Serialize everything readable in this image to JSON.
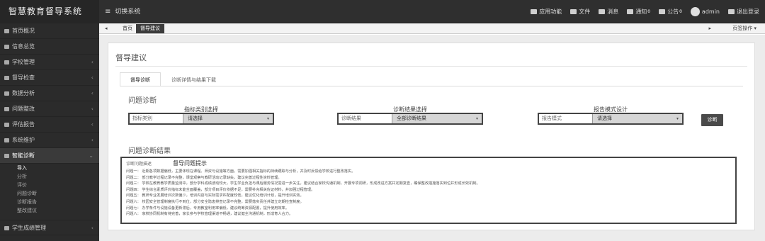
{
  "app": {
    "title": "智慧教育督导系统"
  },
  "header": {
    "system_switch": "切换系统"
  },
  "topnav": [
    {
      "icon": "grid-icon",
      "label": "应用功能",
      "badge": ""
    },
    {
      "icon": "doc-icon",
      "label": "文件",
      "badge": ""
    },
    {
      "icon": "list-icon",
      "label": "消息",
      "badge": ""
    },
    {
      "icon": "bell-icon",
      "label": "通知",
      "badge": "0"
    },
    {
      "icon": "mail-icon",
      "label": "公告",
      "badge": "0"
    },
    {
      "icon": "user-icon",
      "label": "admin",
      "badge": ""
    },
    {
      "icon": "logout-icon",
      "label": "退出登录",
      "badge": ""
    }
  ],
  "sidebar": {
    "items": [
      {
        "label": "首页概况",
        "caret": ""
      },
      {
        "label": "信息总览",
        "caret": ""
      },
      {
        "label": "学校管理",
        "caret": "‹"
      },
      {
        "label": "督导检查",
        "caret": "‹"
      },
      {
        "label": "数据分析",
        "caret": "‹"
      },
      {
        "label": "问题整改",
        "caret": "‹"
      },
      {
        "label": "评估报告",
        "caret": "‹"
      },
      {
        "label": "系统维护",
        "caret": "‹"
      },
      {
        "label": "智能诊断",
        "caret": "⌄"
      }
    ],
    "subitems": [
      {
        "label": "导入"
      },
      {
        "label": "分析"
      },
      {
        "label": "评价"
      },
      {
        "label": "问题诊断"
      },
      {
        "label": "诊断报告"
      },
      {
        "label": "整改建议"
      }
    ],
    "bottom_item": {
      "label": "学生成绩管理",
      "caret": "‹"
    }
  },
  "tabstrip": {
    "back": "◂",
    "home": "首页",
    "current": "督导建议",
    "more": "▸",
    "ops": "页签操作 ▾"
  },
  "main": {
    "title": "督导建议",
    "tabs": [
      {
        "label": "督导诊断"
      },
      {
        "label": "诊断详情与结果下载"
      }
    ],
    "section1_title": "问题诊断",
    "filters": [
      {
        "label": "指标类别选择",
        "placeholder": "指标类别",
        "value": "请选择"
      },
      {
        "label": "诊断结果选择",
        "placeholder": "诊断结果",
        "value": "全部诊断结果"
      },
      {
        "label": "报告模式设计",
        "placeholder": "报告模式",
        "value": "请选择"
      }
    ],
    "search_label": "诊断",
    "section2_title": "问题诊断结果",
    "result": {
      "tag": "诊断问题描述",
      "title": "督导问题提示",
      "lines": [
        "问题一：  近期各项数据偏低，主要体现在课程、师资与设施等方面，需要加强相关指标的持续跟踪与分析，并及时反馈给学校进行整改落实。",
        "问题二：  部分教学过程记录不完整，课堂观察与教研活动记录缺失，建议完善过程性资料管理。",
        "问题三：  学校在教育教学质量监测中，部分学科成绩波动较大，学生学业负担与课后服务情况需进一步关注，建议结合家校沟通机制，开展专项调研，形成改进方案并定期复查，确保整改措施落实到位并形成长效机制。",
        "问题四：  学生综合素质评价指标未能全面覆盖，部分项目评价依据不足，需要补充相关佐证材料，并加强过程管理。",
        "问题五：  教师专业发展培训次数偏少，培训内容与实际需求匹配度较低，建议优化培训计划，提升培训实效。",
        "问题六：  校园安全管理制度执行不到位，部分安全隐患排查记录不完整，需要落实责任并建立定期检查制度。",
        "问题七：  办学条件与设施设备更新滞后，专用教室利用率偏低，建议统筹资源配置，提升使用效率。",
        "问题八：  家校协同机制有待完善，家长参与学校管理渠道不畅通，建议健全沟通机制，形成育人合力。"
      ]
    }
  }
}
